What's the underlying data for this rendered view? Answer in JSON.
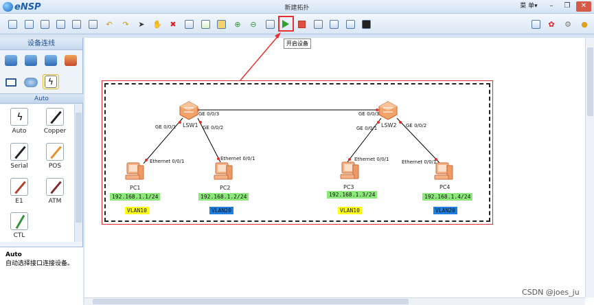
{
  "app": {
    "name": "eNSP",
    "window_title": "新建拓扑",
    "menu_label": "菜 单▾",
    "win_minimize": "–",
    "win_restore": "❐",
    "win_close": "✕"
  },
  "toolbar": {
    "start_devices_tooltip": "开启设备",
    "buttons": [
      "new-topology",
      "open",
      "save",
      "save-as",
      "print",
      "undo",
      "redo",
      "select",
      "pan",
      "delete",
      "delete-link",
      "text-note",
      "rectangle",
      "zoom-in",
      "zoom-out",
      "fit",
      "start-devices",
      "stop-devices",
      "capture",
      "topology-tool",
      "palette",
      "console",
      "chat",
      "huawei",
      "settings",
      "help"
    ]
  },
  "left_panel": {
    "header": "设备连线",
    "categories": [
      "router",
      "switch",
      "wireless",
      "firewall",
      "pc",
      "cloud",
      "cable"
    ],
    "section_title": "Auto",
    "cables": [
      {
        "label": "Auto",
        "color": "#222222"
      },
      {
        "label": "Copper",
        "color": "#222222"
      },
      {
        "label": "Serial",
        "color": "#222222"
      },
      {
        "label": "POS",
        "color": "#e8912a"
      },
      {
        "label": "E1",
        "color": "#b5402e"
      },
      {
        "label": "ATM",
        "color": "#7a2e2e"
      },
      {
        "label": "CTL",
        "color": "#3a8f3a"
      }
    ],
    "description_title": "Auto",
    "description_text": "自动选择接口连接设备。"
  },
  "topology": {
    "switches": [
      {
        "name": "LSW1",
        "port_left": "GE 0/0/1",
        "port_right": "GE 0/0/2",
        "port_trunk": "GE 0/0/3"
      },
      {
        "name": "LSW2",
        "port_left": "GE 0/0/1",
        "port_right": "GE 0/0/2",
        "port_trunk": "GE 0/0/3"
      }
    ],
    "pcs": [
      {
        "name": "PC1",
        "port": "Ethernet 0/0/1",
        "ip": "192.168.1.1/24",
        "vlan": "VLAN10"
      },
      {
        "name": "PC2",
        "port": "Ethernet 0/0/1",
        "ip": "192.168.1.2/24",
        "vlan": "VLAN20"
      },
      {
        "name": "PC3",
        "port": "Ethernet 0/0/1",
        "ip": "192.168.1.3/24",
        "vlan": "VLAN10"
      },
      {
        "name": "PC4",
        "port": "Ethernet 0/0/1",
        "ip": "192.168.1.4/24",
        "vlan": "VLAN20"
      }
    ],
    "colors": {
      "ip_bg": "#8ce87a",
      "vlan10_bg": "#ffff1a",
      "vlan20_bg": "#1f7fe0",
      "link": "#000000",
      "port_dot": "#e03030",
      "annotation": "#e53030"
    }
  },
  "watermark": "CSDN @joes_ju"
}
